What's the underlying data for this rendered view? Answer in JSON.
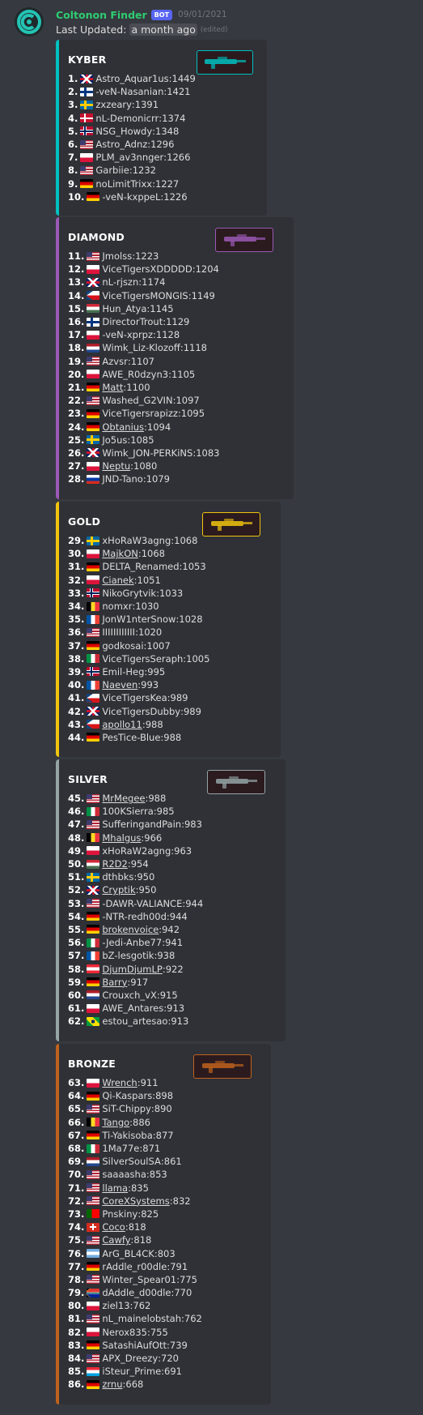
{
  "message": {
    "username": "Coltonon Finder",
    "bot_tag": "BOT",
    "timestamp": "09/01/2021",
    "updated_prefix": "Last Updated:",
    "updated_value": "a month ago",
    "edited": "(edited)"
  },
  "colors": {
    "background": "#36393f",
    "embed_bg": "#2f3136",
    "username": "#2ecc71",
    "bot_tag": "#5865f2"
  },
  "flag_styles": {
    "gb": "linear-gradient(45deg,transparent 43%,#fff 43%,#fff 57%,transparent 57%),linear-gradient(-45deg,transparent 43%,#fff 43%,#fff 57%,transparent 57%),linear-gradient(#cf142b,#cf142b) center/100% 3px no-repeat,linear-gradient(#cf142b,#cf142b) center/3px 100% no-repeat,#012169",
    "fi": "linear-gradient(#003580,#003580) 5px 0/3px 100% no-repeat,linear-gradient(#003580,#003580) 0 4px/100% 3px no-repeat,#fff",
    "se": "linear-gradient(#fecc00,#fecc00) 5px 0/3px 100% no-repeat,linear-gradient(#fecc00,#fecc00) 0 4px/100% 3px no-repeat,#006aa7",
    "dk": "linear-gradient(#fff,#fff) 5px 0/2px 100% no-repeat,linear-gradient(#fff,#fff) 0 4.5px/100% 2px no-repeat,#c8102e",
    "no": "linear-gradient(#00205b,#00205b) 5px 0/2px 100% no-repeat,linear-gradient(#00205b,#00205b) 0 4.5px/100% 2px no-repeat,linear-gradient(#fff,#fff) 4px 0/4px 100% no-repeat,linear-gradient(#fff,#fff) 0 3.5px/100% 4px no-repeat,#ba0c2f",
    "us": "linear-gradient(#3c3b6e,#3c3b6e) 0 0/7px 6px no-repeat,repeating-linear-gradient(#b22234 0 1.6px,#fff 1.6px 3.2px)",
    "pl": "linear-gradient(#fff 50%,#dc143c 50%)",
    "de": "linear-gradient(#000 33%,#dd0000 33% 66%,#ffce00 66%)",
    "cz": "linear-gradient(to bottom right,#11457e 50%,transparent 50%) 0 0/8px 50% no-repeat,linear-gradient(to top right,#11457e 50%,transparent 50%) 0 100%/8px 50% no-repeat,linear-gradient(#fff 50%,#d7141a 50%)",
    "hu": "linear-gradient(#ce2939 33%,#fff 33% 66%,#477050 66%)",
    "ru": "linear-gradient(#fff 33%,#0039a6 33% 66%,#d52b1e 66%)",
    "nl": "linear-gradient(#ae1c28 33%,#fff 33% 66%,#21468b 66%)",
    "be": "linear-gradient(90deg,#000 33%,#fdda24 33% 66%,#ef3340 66%)",
    "fr": "linear-gradient(90deg,#0055a4 33%,#fff 33% 66%,#ef4135 66%)",
    "it": "linear-gradient(90deg,#009246 33%,#fff 33% 66%,#ce2b37 66%)",
    "at": "linear-gradient(#ed2939 33%,#fff 33% 66%,#ed2939 66%)",
    "lu": "linear-gradient(#ed2939 33%,#fff 33% 66%,#00a1de 66%)",
    "br": "radial-gradient(circle,#002776 22%,transparent 23%),linear-gradient(45deg,transparent 30%,#ffdf00 30% 70%,transparent 70%) center/100% 100%,#009c3b",
    "pt": "linear-gradient(90deg,#006600 40%,#ff0000 40%)",
    "ch": "linear-gradient(#fff,#fff) center/8px 2px no-repeat,linear-gradient(#fff,#fff) center/2px 8px no-repeat,#d52b1e",
    "ar": "linear-gradient(#74acdf 33%,#fff 33% 66%,#74acdf 66%)",
    "za": "linear-gradient(to bottom right,#000 25%,#ffb612 25% 30%,transparent 30%) 0 0/8px 50% no-repeat,linear-gradient(to top right,#000 25%,#ffb612 25% 30%,transparent 30%) 0 100%/8px 50% no-repeat,linear-gradient(#de3831 40%,#fff 40% 45%,#007a4d 45% 55%,#fff 55% 60%,#002395 60%)"
  },
  "tiers": [
    {
      "name": "KYBER",
      "color": "#00c0c0",
      "thumb_icon": "kyber-rifle-icon",
      "players": [
        {
          "rank": "1.",
          "flag": "gb",
          "name": "Astro_Aquar1us",
          "score": "1449"
        },
        {
          "rank": "2.",
          "flag": "fi",
          "name": "-veN-Nasanian",
          "score": "1421"
        },
        {
          "rank": "3.",
          "flag": "se",
          "name": "zxzeary",
          "score": "1391"
        },
        {
          "rank": "4.",
          "flag": "dk",
          "name": "nL-Demonicrr",
          "score": "1374"
        },
        {
          "rank": "5.",
          "flag": "no",
          "name": "NSG_Howdy",
          "score": "1348"
        },
        {
          "rank": "6.",
          "flag": "us",
          "name": "Astro_Adnz",
          "score": "1296"
        },
        {
          "rank": "7.",
          "flag": "pl",
          "name": "PLM_av3nnger",
          "score": "1266"
        },
        {
          "rank": "8.",
          "flag": "us",
          "name": "Garbiie",
          "score": "1232"
        },
        {
          "rank": "9.",
          "flag": "de",
          "name": "noLimitTrixx",
          "score": "1227"
        },
        {
          "rank": "10.",
          "flag": "de",
          "name": "-veN-kxppeL",
          "score": "1226"
        }
      ]
    },
    {
      "name": "DIAMOND",
      "color": "#9b59b6",
      "thumb_icon": "diamond-blaster-icon",
      "players": [
        {
          "rank": "11.",
          "flag": "us",
          "name": "Jmolss",
          "score": "1223"
        },
        {
          "rank": "12.",
          "flag": "pl",
          "name": "ViceTigersXDDDDD",
          "score": "1204"
        },
        {
          "rank": "13.",
          "flag": "gb",
          "name": "nL-rjszn",
          "score": "1174"
        },
        {
          "rank": "14.",
          "flag": "cz",
          "name": "ViceTigersMONGIS",
          "score": "1149"
        },
        {
          "rank": "15.",
          "flag": "hu",
          "name": "Hun_Atya",
          "score": "1145"
        },
        {
          "rank": "16.",
          "flag": "fi",
          "name": "DirectorTrout",
          "score": "1129"
        },
        {
          "rank": "17.",
          "flag": "pl",
          "name": "-veN-xprpz",
          "score": "1128"
        },
        {
          "rank": "18.",
          "flag": "nl",
          "name": "Wimk_Liz-Klozoff",
          "score": "1118"
        },
        {
          "rank": "19.",
          "flag": "us",
          "name": "Azvsr",
          "score": "1107"
        },
        {
          "rank": "20.",
          "flag": "pl",
          "name": "AWE_R0dzyn3",
          "score": "1105"
        },
        {
          "rank": "21.",
          "flag": "de",
          "name": "Matt",
          "score": "1100",
          "link": true
        },
        {
          "rank": "22.",
          "flag": "us",
          "name": "Washed_G2VIN",
          "score": "1097"
        },
        {
          "rank": "23.",
          "flag": "de",
          "name": "ViceTigersrapizz",
          "score": "1095"
        },
        {
          "rank": "24.",
          "flag": "de",
          "name": "Obtanius",
          "score": "1094",
          "link": true
        },
        {
          "rank": "25.",
          "flag": "se",
          "name": "Jo5us",
          "score": "1085"
        },
        {
          "rank": "26.",
          "flag": "gb",
          "name": "Wimk_JON-PERKiNS",
          "score": "1083"
        },
        {
          "rank": "27.",
          "flag": "pl",
          "name": "Neptu",
          "score": "1080",
          "link": true
        },
        {
          "rank": "28.",
          "flag": "ru",
          "name": "JND-Tano",
          "score": "1079"
        }
      ]
    },
    {
      "name": "GOLD",
      "color": "#f1c40f",
      "thumb_icon": "gold-blaster-icon",
      "players": [
        {
          "rank": "29.",
          "flag": "se",
          "name": "xHoRaW3agng",
          "score": "1068"
        },
        {
          "rank": "30.",
          "flag": "pl",
          "name": "MajkON",
          "score": "1068",
          "link": true
        },
        {
          "rank": "31.",
          "flag": "de",
          "name": "DELTA_Renamed",
          "score": "1053"
        },
        {
          "rank": "32.",
          "flag": "pl",
          "name": "Cianek",
          "score": "1051",
          "link": true
        },
        {
          "rank": "33.",
          "flag": "no",
          "name": "NikoGrytvik",
          "score": "1033"
        },
        {
          "rank": "34.",
          "flag": "be",
          "name": "nomxr",
          "score": "1030"
        },
        {
          "rank": "35.",
          "flag": "fr",
          "name": "JonW1nterSnow",
          "score": "1028"
        },
        {
          "rank": "36.",
          "flag": "us",
          "name": "IIIIIIIIIIII",
          "score": "1020"
        },
        {
          "rank": "37.",
          "flag": "de",
          "name": "godkosai",
          "score": "1007"
        },
        {
          "rank": "38.",
          "flag": "it",
          "name": "ViceTigersSeraph",
          "score": "1005"
        },
        {
          "rank": "39.",
          "flag": "no",
          "name": "Emil-Heg",
          "score": "995"
        },
        {
          "rank": "40.",
          "flag": "fr",
          "name": "Naeven",
          "score": "993",
          "link": true
        },
        {
          "rank": "41.",
          "flag": "cz",
          "name": "ViceTigersKea",
          "score": "989"
        },
        {
          "rank": "42.",
          "flag": "gb",
          "name": "ViceTigersDubby",
          "score": "989"
        },
        {
          "rank": "43.",
          "flag": "cz",
          "name": "apollo11",
          "score": "988",
          "link": true
        },
        {
          "rank": "44.",
          "flag": "de",
          "name": "PesTice-Blue",
          "score": "988"
        }
      ]
    },
    {
      "name": "SILVER",
      "color": "#95a5a6",
      "thumb_icon": "silver-blaster-icon",
      "players": [
        {
          "rank": "45.",
          "flag": "us",
          "name": "MrMegee",
          "score": "988",
          "link": true
        },
        {
          "rank": "46.",
          "flag": "it",
          "name": "100KSierra",
          "score": "985"
        },
        {
          "rank": "47.",
          "flag": "us",
          "name": "SufferingandPain",
          "score": "983"
        },
        {
          "rank": "48.",
          "flag": "be",
          "name": "Mhalgus",
          "score": "966",
          "link": true
        },
        {
          "rank": "49.",
          "flag": "pl",
          "name": "xHoRaW2agng",
          "score": "963"
        },
        {
          "rank": "50.",
          "flag": "hu",
          "name": "R2D2",
          "score": "954",
          "link": true
        },
        {
          "rank": "51.",
          "flag": "se",
          "name": "dthbks",
          "score": "950"
        },
        {
          "rank": "52.",
          "flag": "gb",
          "name": "Cryptik",
          "score": "950",
          "link": true
        },
        {
          "rank": "53.",
          "flag": "us",
          "name": "-DAWR-VALIANCE",
          "score": "944"
        },
        {
          "rank": "54.",
          "flag": "de",
          "name": "-NTR-redh00d",
          "score": "944"
        },
        {
          "rank": "55.",
          "flag": "de",
          "name": "brokenvoice",
          "score": "942",
          "link": true
        },
        {
          "rank": "56.",
          "flag": "it",
          "name": "-Jedi-Anbe77",
          "score": "941"
        },
        {
          "rank": "57.",
          "flag": "fr",
          "name": "bZ-lesgotik",
          "score": "938"
        },
        {
          "rank": "58.",
          "flag": "at",
          "name": "DjumDjumLP",
          "score": "922",
          "link": true
        },
        {
          "rank": "59.",
          "flag": "de",
          "name": "Barry",
          "score": "917",
          "link": true
        },
        {
          "rank": "60.",
          "flag": "nl",
          "name": "Crouxch_vX",
          "score": "915"
        },
        {
          "rank": "61.",
          "flag": "pl",
          "name": "AWE_Antares",
          "score": "913"
        },
        {
          "rank": "62.",
          "flag": "br",
          "name": "estou_artesao",
          "score": "913"
        }
      ]
    },
    {
      "name": "BRONZE",
      "color": "#c0621d",
      "thumb_icon": "bronze-blaster-icon",
      "players": [
        {
          "rank": "63.",
          "flag": "pl",
          "name": "Wrench",
          "score": "911",
          "link": true
        },
        {
          "rank": "64.",
          "flag": "de",
          "name": "Qi-Kaspars",
          "score": "898"
        },
        {
          "rank": "65.",
          "flag": "us",
          "name": "SiT-Chippy",
          "score": "890"
        },
        {
          "rank": "66.",
          "flag": "be",
          "name": "Tango",
          "score": "886",
          "link": true
        },
        {
          "rank": "67.",
          "flag": "de",
          "name": "Ti-Yakisoba",
          "score": "877"
        },
        {
          "rank": "68.",
          "flag": "it",
          "name": "1Ma77e",
          "score": "871"
        },
        {
          "rank": "69.",
          "flag": "nl",
          "name": "SilverSoulSA",
          "score": "861"
        },
        {
          "rank": "70.",
          "flag": "us",
          "name": "saaaasha",
          "score": "853"
        },
        {
          "rank": "71.",
          "flag": "us",
          "name": "llama",
          "score": "835",
          "link": true
        },
        {
          "rank": "72.",
          "flag": "us",
          "name": "CoreXSystems",
          "score": "832",
          "link": true
        },
        {
          "rank": "73.",
          "flag": "pt",
          "name": "Pnskiny",
          "score": "825"
        },
        {
          "rank": "74.",
          "flag": "ch",
          "name": "Coco",
          "score": "818",
          "link": true
        },
        {
          "rank": "75.",
          "flag": "us",
          "name": "Cawfy",
          "score": "818",
          "link": true
        },
        {
          "rank": "76.",
          "flag": "ar",
          "name": "ArG_BL4CK",
          "score": "803"
        },
        {
          "rank": "77.",
          "flag": "de",
          "name": "rAddle_r00dle",
          "score": "791"
        },
        {
          "rank": "78.",
          "flag": "us",
          "name": "Winter_Spear01",
          "score": "775"
        },
        {
          "rank": "79.",
          "flag": "za",
          "name": "dAddle_d00dle",
          "score": "770"
        },
        {
          "rank": "80.",
          "flag": "pl",
          "name": "ziel13",
          "score": "762"
        },
        {
          "rank": "81.",
          "flag": "us",
          "name": "nL_mainelobstah",
          "score": "762"
        },
        {
          "rank": "82.",
          "flag": "pl",
          "name": "Nerox835",
          "score": "755"
        },
        {
          "rank": "83.",
          "flag": "de",
          "name": "SatashiAufOtt",
          "score": "739"
        },
        {
          "rank": "84.",
          "flag": "us",
          "name": "APX_Dreezy",
          "score": "720"
        },
        {
          "rank": "85.",
          "flag": "lu",
          "name": "iSteur_Prime",
          "score": "691"
        },
        {
          "rank": "86.",
          "flag": "de",
          "name": "zrnu",
          "score": "668",
          "link": true
        }
      ]
    }
  ]
}
